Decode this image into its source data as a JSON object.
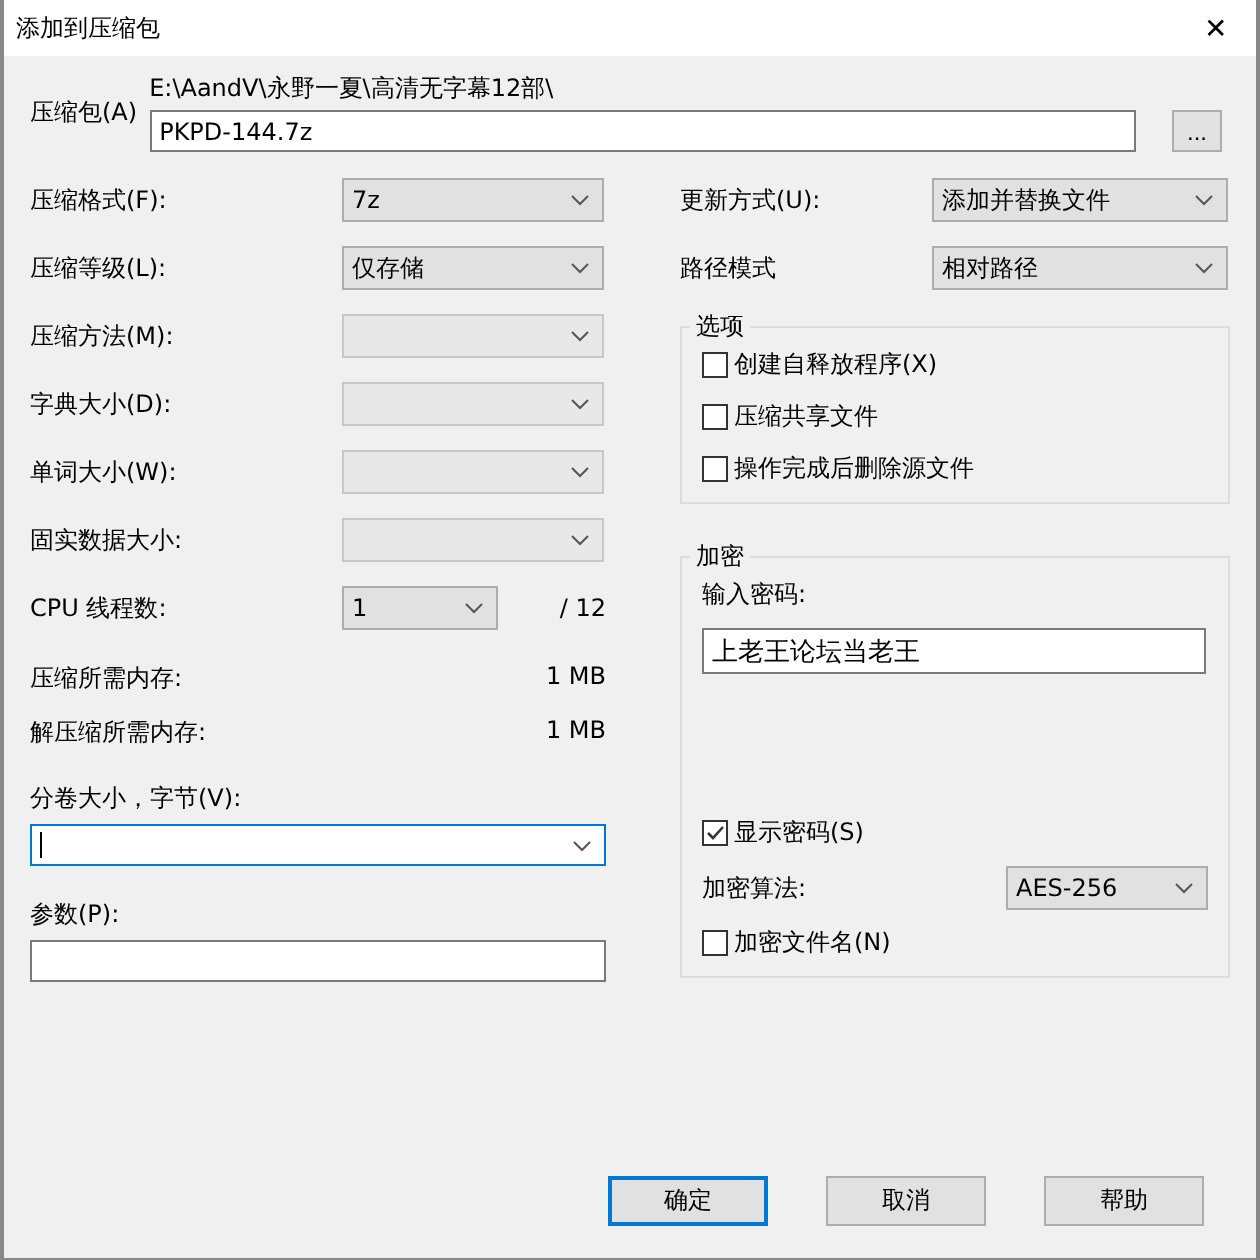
{
  "window": {
    "title": "添加到压缩包",
    "close": "✕"
  },
  "archive": {
    "label": "压缩包(A)",
    "path": "E:\\AandV\\永野一夏\\高清无字幕12部\\",
    "value": "PKPD-144.7z",
    "browse": "..."
  },
  "left_settings": [
    {
      "label": "压缩格式(F):",
      "value": "7z",
      "disabled": false
    },
    {
      "label": "压缩等级(L):",
      "value": "仅存储",
      "disabled": false
    },
    {
      "label": "压缩方法(M):",
      "disabled": true
    },
    {
      "label": "字典大小(D):",
      "disabled": true
    },
    {
      "label": "单词大小(W):",
      "disabled": true
    },
    {
      "label": "固实数据大小:",
      "disabled": true
    }
  ],
  "cpu": {
    "label": "CPU 线程数:",
    "value": "1",
    "max": "/ 12"
  },
  "memory": [
    {
      "label": "压缩所需内存:",
      "value": "1 MB"
    },
    {
      "label": "解压缩所需内存:",
      "value": "1 MB"
    }
  ],
  "split": {
    "label": "分卷大小，字节(V):",
    "focused": true
  },
  "parameters": {
    "label": "参数(P):"
  },
  "right_settings": [
    {
      "label": "更新方式(U):",
      "value": "添加并替换文件"
    },
    {
      "label": "路径模式",
      "value": "相对路径"
    }
  ],
  "options": {
    "title": "选项",
    "items": [
      {
        "label": "创建自释放程序(X)",
        "checked": false
      },
      {
        "label": "压缩共享文件",
        "checked": false
      },
      {
        "label": "操作完成后删除源文件",
        "checked": false
      }
    ]
  },
  "encryption": {
    "title": "加密",
    "password_label": "输入密码:",
    "password": "上老王论坛当老王",
    "show_password": {
      "label": "显示密码(S)",
      "checked": true
    },
    "method_label": "加密算法:",
    "method": "AES-256",
    "encrypt_names": {
      "label": "加密文件名(N)",
      "checked": false
    }
  },
  "buttons": [
    {
      "label": "确定",
      "default": true
    },
    {
      "label": "取消",
      "default": false
    },
    {
      "label": "帮助",
      "default": false
    }
  ]
}
